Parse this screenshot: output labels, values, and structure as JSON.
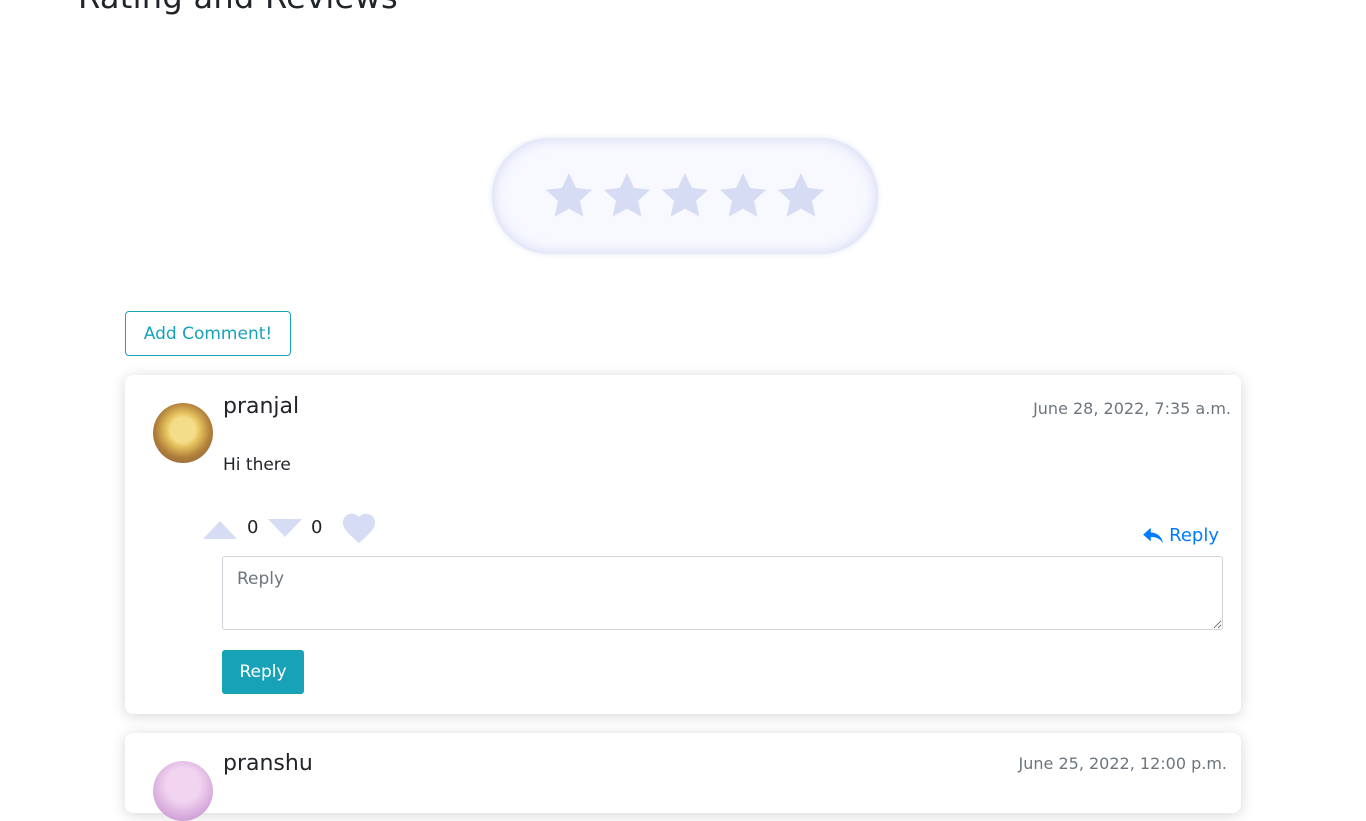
{
  "page": {
    "heading": "Rating and Reviews"
  },
  "rating": {
    "stars_total": 5,
    "stars_selected": 0,
    "star_color": "#d6dcf3"
  },
  "add_comment": {
    "label": "Add Comment!"
  },
  "comments": [
    {
      "username": "pranjal",
      "timestamp": "June 28, 2022, 7:35 a.m.",
      "body": "Hi there",
      "upvotes": "0",
      "downvotes": "0",
      "reply_link_label": "Reply",
      "reply_placeholder": "Reply",
      "reply_button_label": "Reply"
    },
    {
      "username": "pranshu",
      "timestamp": "June 25, 2022, 12:00 p.m."
    }
  ],
  "icons": {
    "star": "star-icon",
    "upvote": "triangle-up-icon",
    "downvote": "triangle-down-icon",
    "like": "heart-icon",
    "reply": "reply-arrow-icon"
  },
  "colors": {
    "accent": "#17a2b8",
    "link": "#007bff",
    "muted_icon": "#d6dcf3"
  }
}
